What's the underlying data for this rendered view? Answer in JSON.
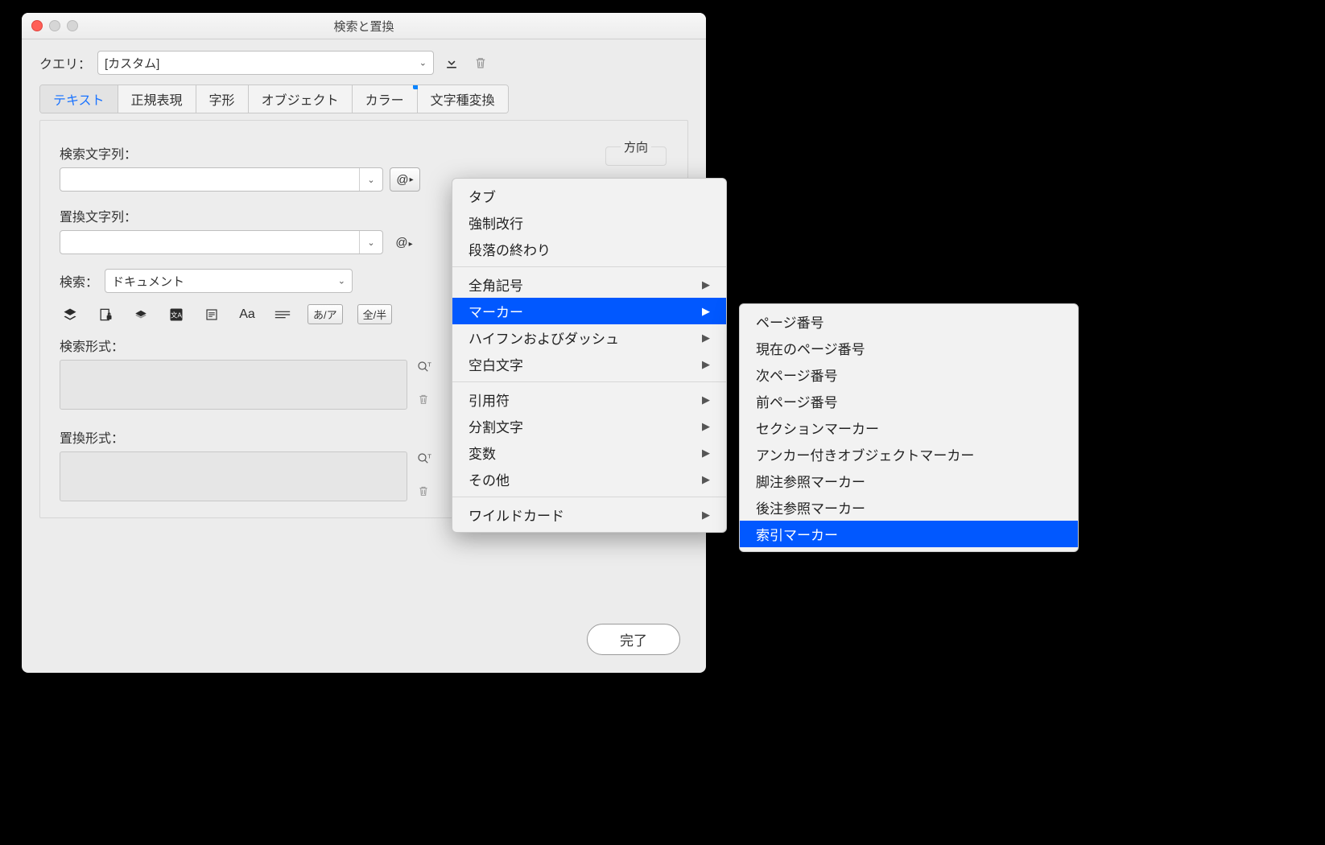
{
  "window": {
    "title": "検索と置換"
  },
  "query": {
    "label": "クエリ：",
    "value": "[カスタム]"
  },
  "tabs": {
    "text": "テキスト",
    "regex": "正規表現",
    "glyph": "字形",
    "object": "オブジェクト",
    "color": "カラー",
    "transliterate": "文字種変換"
  },
  "find": {
    "label": "検索文字列：",
    "at_label": "@"
  },
  "replace": {
    "label": "置換文字列：",
    "at_label": "@"
  },
  "direction": {
    "legend": "方向"
  },
  "scope": {
    "label": "検索：",
    "value": "ドキュメント"
  },
  "options": {
    "kana_toggle": "あ/ア",
    "width_toggle": "全/半",
    "case_label": "Aa"
  },
  "findformat": {
    "label": "検索形式："
  },
  "replaceformat": {
    "label": "置換形式："
  },
  "done": "完了",
  "menu1": {
    "tab": "タブ",
    "forced_break": "強制改行",
    "end_para": "段落の終わり",
    "fullwidth_sym": "全角記号",
    "marker": "マーカー",
    "hyphen_dash": "ハイフンおよびダッシュ",
    "whitespace": "空白文字",
    "quotes": "引用符",
    "break_chars": "分割文字",
    "variables": "変数",
    "other": "その他",
    "wildcard": "ワイルドカード"
  },
  "menu2": {
    "page_number": "ページ番号",
    "current_page": "現在のページ番号",
    "next_page": "次ページ番号",
    "prev_page": "前ページ番号",
    "section_marker": "セクションマーカー",
    "anchored_obj": "アンカー付きオブジェクトマーカー",
    "footnote_ref": "脚注参照マーカー",
    "endnote_ref": "後注参照マーカー",
    "index_marker": "索引マーカー"
  }
}
